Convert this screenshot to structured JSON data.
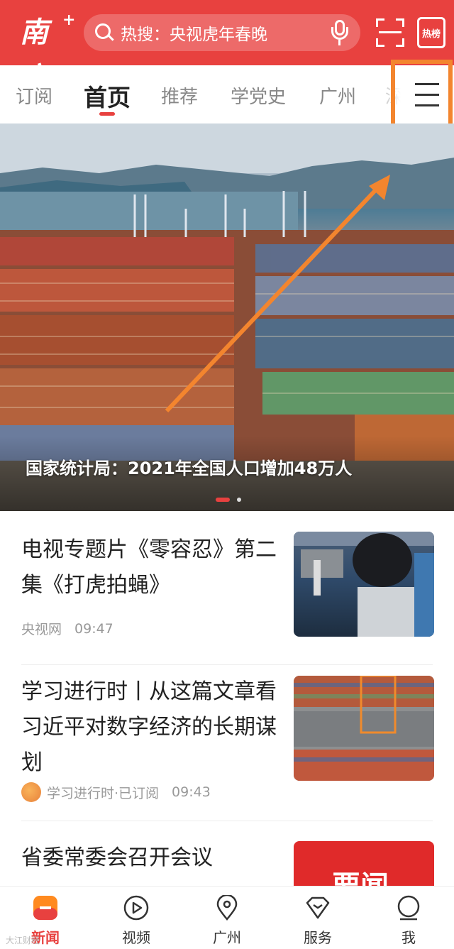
{
  "app": {
    "logo_text": "南方",
    "logo_plus": "+"
  },
  "header": {
    "search_text": "热搜：央视虎年春晚",
    "hot_label": "热榜"
  },
  "tabs": [
    {
      "label": "订阅"
    },
    {
      "label": "首页",
      "active": true
    },
    {
      "label": "推荐"
    },
    {
      "label": "学党史"
    },
    {
      "label": "广州"
    },
    {
      "label": "深"
    }
  ],
  "hero": {
    "title": "国家统计局：2021年全国人口增加48万人",
    "slide_count": 2,
    "active_slide": 1
  },
  "news": [
    {
      "title": "电视专题片《零容忍》第二集《打虎拍蝇》",
      "source": "央视网",
      "time": "09:47"
    },
    {
      "title": "学习进行时丨从这篇文章看习近平对数字经济的长期谋划",
      "source": "学习进行时·已订阅",
      "time": "09:43"
    },
    {
      "title": "省委常委会召开会议",
      "thumb_text": "要闻"
    }
  ],
  "bottom_nav": [
    {
      "label": "新闻",
      "icon": "news-icon",
      "active": true
    },
    {
      "label": "视频",
      "icon": "video-icon"
    },
    {
      "label": "广州",
      "icon": "location-icon"
    },
    {
      "label": "服务",
      "icon": "service-icon"
    },
    {
      "label": "我",
      "icon": "profile-icon"
    }
  ],
  "colors": {
    "brand": "#e8413f",
    "annotation": "#f3852e"
  },
  "watermark": "大江财经"
}
